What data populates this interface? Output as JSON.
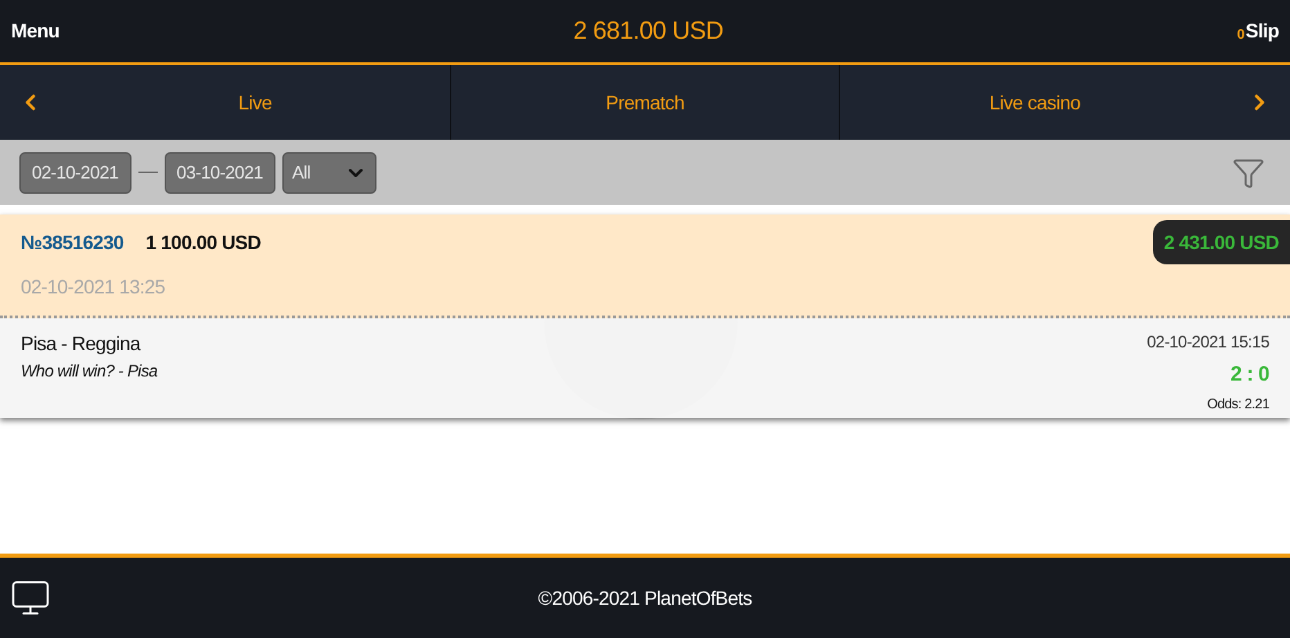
{
  "header": {
    "menu": "Menu",
    "balance": "2 681.00 USD",
    "slip_count": "0",
    "slip": "Slip"
  },
  "nav": {
    "tabs": [
      {
        "label": "Live"
      },
      {
        "label": "Prematch"
      },
      {
        "label": "Live casino"
      }
    ]
  },
  "filter": {
    "date_from": "02-10-2021",
    "date_to": "03-10-2021",
    "type": "All"
  },
  "bets": [
    {
      "number": "№38516230",
      "stake": "1 100.00 USD",
      "payout": "2 431.00 USD",
      "placed": "02-10-2021 13:25",
      "events": [
        {
          "match": "Pisa - Reggina",
          "market": "Who will win? - Pisa",
          "time": "02-10-2021 15:15",
          "score": "2 : 0",
          "odds": "Odds: 2.21"
        }
      ]
    }
  ],
  "footer": {
    "copyright": "©2006-2021 PlanetOfBets"
  }
}
